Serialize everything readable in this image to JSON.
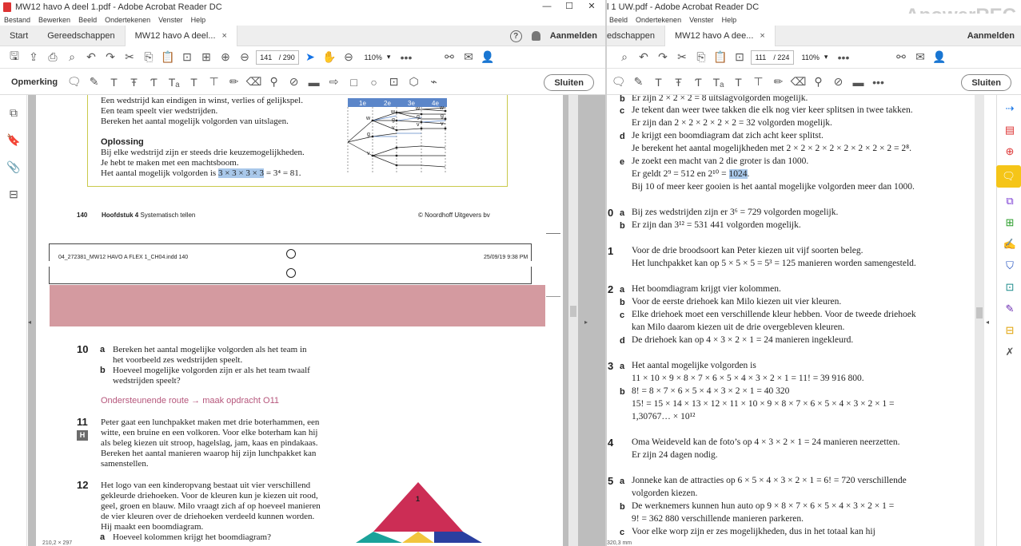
{
  "left": {
    "window_title": "MW12 havo A deel 1.pdf - Adobe Acrobat Reader DC",
    "menu": [
      "Bestand",
      "Bewerken",
      "Beeld",
      "Ondertekenen",
      "Venster",
      "Help"
    ],
    "tabs": {
      "start": "Start",
      "tools": "Gereedschappen",
      "doc": "MW12 havo A deel...",
      "close": "×"
    },
    "help": "?",
    "signin": "Aanmelden",
    "page_current": "141",
    "page_total": "/ 290",
    "zoom": "110%",
    "comment_label": "Opmerking",
    "close_btn": "Sluiten",
    "textbook": {
      "intro": [
        "Een wedstrijd kan eindigen in winst, verlies of gelijkspel.",
        "Een team speelt vier wedstrijden.",
        "Bereken het aantal mogelijk volgorden van uitslagen."
      ],
      "oplossing_title": "Oplossing",
      "oplossing": [
        "Bij elke wedstrijd zijn er steeds drie keuzemogelijkheden.",
        "Je hebt te maken met een machtsboom."
      ],
      "result_prefix": "Het aantal mogelijk volgorden is ",
      "result_hl": "3 × 3 × 3 × 3",
      "result_suffix": " = 3⁴ = 81.",
      "tree_headers": [
        "1e",
        "2e",
        "3e",
        "4e"
      ],
      "tree_labels": [
        "w",
        "g",
        "v",
        "w",
        "g",
        "v",
        "w",
        "g",
        "v",
        "w",
        "g",
        "v"
      ],
      "footer_page": "140",
      "footer_chapter_bold": "Hoofdstuk 4",
      "footer_chapter": " Systematisch tellen",
      "footer_right": "© Noordhoff Uitgevers bv",
      "indd": "04_272381_MW12 HAVO A FLEX 1_CH04.indd   140",
      "indd_date": "25/09/19   9:38 PM",
      "q10_num": "10",
      "q10a": [
        "Bereken het aantal mogelijke volgorden als het team in",
        "het voorbeeld zes wedstrijden speelt."
      ],
      "q10b": [
        "Hoeveel mogelijke volgorden zijn er als het team twaalf",
        "wedstrijden speelt?"
      ],
      "route": "Ondersteunende route → maak opdracht O11",
      "q11_num": "11",
      "q11_badge": "H",
      "q11": [
        "Peter gaat een lunchpakket maken met drie boterhammen, een",
        "witte, een bruine en een volkoren. Voor elke boterham kan hij",
        "als beleg kiezen uit stroop, hagelslag, jam, kaas en pindakaas.",
        "Bereken het aantal manieren waarop hij zijn lunchpakket kan",
        "samenstellen."
      ],
      "q12_num": "12",
      "q12": [
        "Het logo van een kinderopvang bestaat uit vier verschillend",
        "gekleurde driehoeken. Voor de kleuren kun je kiezen uit rood,",
        "geel, groen en blauw. Milo vraagt zich af op hoeveel manieren",
        "de vier kleuren over de driehoeken verdeeld kunnen worden.",
        "Hij maakt een boomdiagram."
      ],
      "q12a": "Hoeveel kolommen krijgt het boomdiagram?",
      "logo_label": "1",
      "coords": "210,2 × 297"
    },
    "colors": {
      "pink": "#d49aa0",
      "logo_red": "#cc2d55",
      "logo_blue": "#2a3fa0",
      "logo_teal": "#1aa29a",
      "logo_yellow": "#f2c53d"
    }
  },
  "right": {
    "window_title": "l 1 UW.pdf - Adobe Acrobat Reader DC",
    "menu": [
      "Beeld",
      "Ondertekenen",
      "Venster",
      "Help"
    ],
    "tabs": {
      "tools": "edschappen",
      "doc": "MW12 havo A dee...",
      "close": "×"
    },
    "signin": "Aanmelden",
    "page_current": "111",
    "page_total": "/ 224",
    "zoom": "110%",
    "close_btn": "Sluiten",
    "watermark": "ApowerREC",
    "coords": "320,3 mm",
    "answers": [
      {
        "n": "",
        "l": "b",
        "t": "Er zijn 2 × 2 × 2 = 8 uitslagvolgorden mogelijk."
      },
      {
        "n": "",
        "l": "c",
        "t": "Je tekent dan weer twee takken die elk nog vier keer splitsen in twee takken."
      },
      {
        "n": "",
        "l": "",
        "t": "Er zijn dan 2 × 2 × 2 × 2 × 2 = 32 volgorden mogelijk."
      },
      {
        "n": "",
        "l": "d",
        "t": "Je krijgt een boomdiagram dat zich acht keer splitst."
      },
      {
        "n": "",
        "l": "",
        "t": "Je berekent het aantal mogelijkheden met 2 × 2 × 2 × 2 × 2 × 2 × 2 × 2 = 2⁸."
      },
      {
        "n": "",
        "l": "e",
        "t": "Je zoekt een macht van 2 die groter is dan 1000."
      },
      {
        "n": "",
        "l": "",
        "t": "Er geldt 2⁹ = 512 en 2¹⁰ = ",
        "hl": "1024",
        "after": "."
      },
      {
        "n": "",
        "l": "",
        "t": "Bij 10 of meer keer gooien is het aantal mogelijke volgorden meer dan 1000."
      },
      {
        "n": "0",
        "l": "a",
        "t": "Bij zes wedstrijden zijn er 3⁶ = 729 volgorden mogelijk."
      },
      {
        "n": "",
        "l": "b",
        "t": "Er zijn dan 3¹² = 531 441 volgorden mogelijk."
      },
      {
        "n": "1",
        "l": "",
        "t": "Voor de drie broodsoort kan Peter kiezen uit vijf soorten beleg."
      },
      {
        "n": "",
        "l": "",
        "t": "Het lunchpakket kan op 5 × 5 × 5 = 5³ = 125 manieren worden samengesteld."
      },
      {
        "n": "2",
        "l": "a",
        "t": "Het boomdiagram krijgt vier kolommen."
      },
      {
        "n": "",
        "l": "b",
        "t": "Voor de eerste driehoek kan Milo kiezen uit vier kleuren."
      },
      {
        "n": "",
        "l": "c",
        "t": "Elke driehoek moet een verschillende kleur hebben. Voor de tweede driehoek"
      },
      {
        "n": "",
        "l": "",
        "t": "kan Milo daarom kiezen uit de drie overgebleven kleuren."
      },
      {
        "n": "",
        "l": "d",
        "t": "De driehoek kan op 4 × 3 × 2 × 1 = 24 manieren ingekleurd."
      },
      {
        "n": "3",
        "l": "a",
        "t": "Het aantal mogelijke volgorden is"
      },
      {
        "n": "",
        "l": "",
        "t": "11 × 10 × 9 × 8 × 7 × 6 × 5 × 4 × 3 × 2 × 1 = 11! = 39 916 800."
      },
      {
        "n": "",
        "l": "b",
        "t": "8! = 8 × 7 × 6 × 5 × 4 × 3 × 2 × 1 = 40 320"
      },
      {
        "n": "",
        "l": "",
        "t": "15! = 15 × 14 × 13 × 12 × 11 × 10 × 9 × 8 × 7 × 6 × 5 × 4 × 3 × 2 × 1 ="
      },
      {
        "n": "",
        "l": "",
        "t": "1,30767… × 10¹²"
      },
      {
        "n": "4",
        "l": "",
        "t": "Oma Weideveld kan de foto’s op 4 × 3 × 2 × 1 = 24 manieren neerzetten."
      },
      {
        "n": "",
        "l": "",
        "t": "Er zijn 24 dagen nodig."
      },
      {
        "n": "5",
        "l": "a",
        "t": "Jonneke kan de attracties op 6 × 5 × 4 × 3 × 2 × 1 = 6! = 720 verschillende"
      },
      {
        "n": "",
        "l": "",
        "t": "volgorden kiezen."
      },
      {
        "n": "",
        "l": "b",
        "t": "De werknemers kunnen hun auto op 9 × 8 × 7 × 6 × 5 × 4 × 3 × 2 × 1 ="
      },
      {
        "n": "",
        "l": "",
        "t": "9! = 362 880 verschillende manieren parkeren."
      },
      {
        "n": "",
        "l": "c",
        "t": "Voor elke worp zijn er zes mogelijkheden, dus in het totaal kan hij"
      }
    ]
  }
}
